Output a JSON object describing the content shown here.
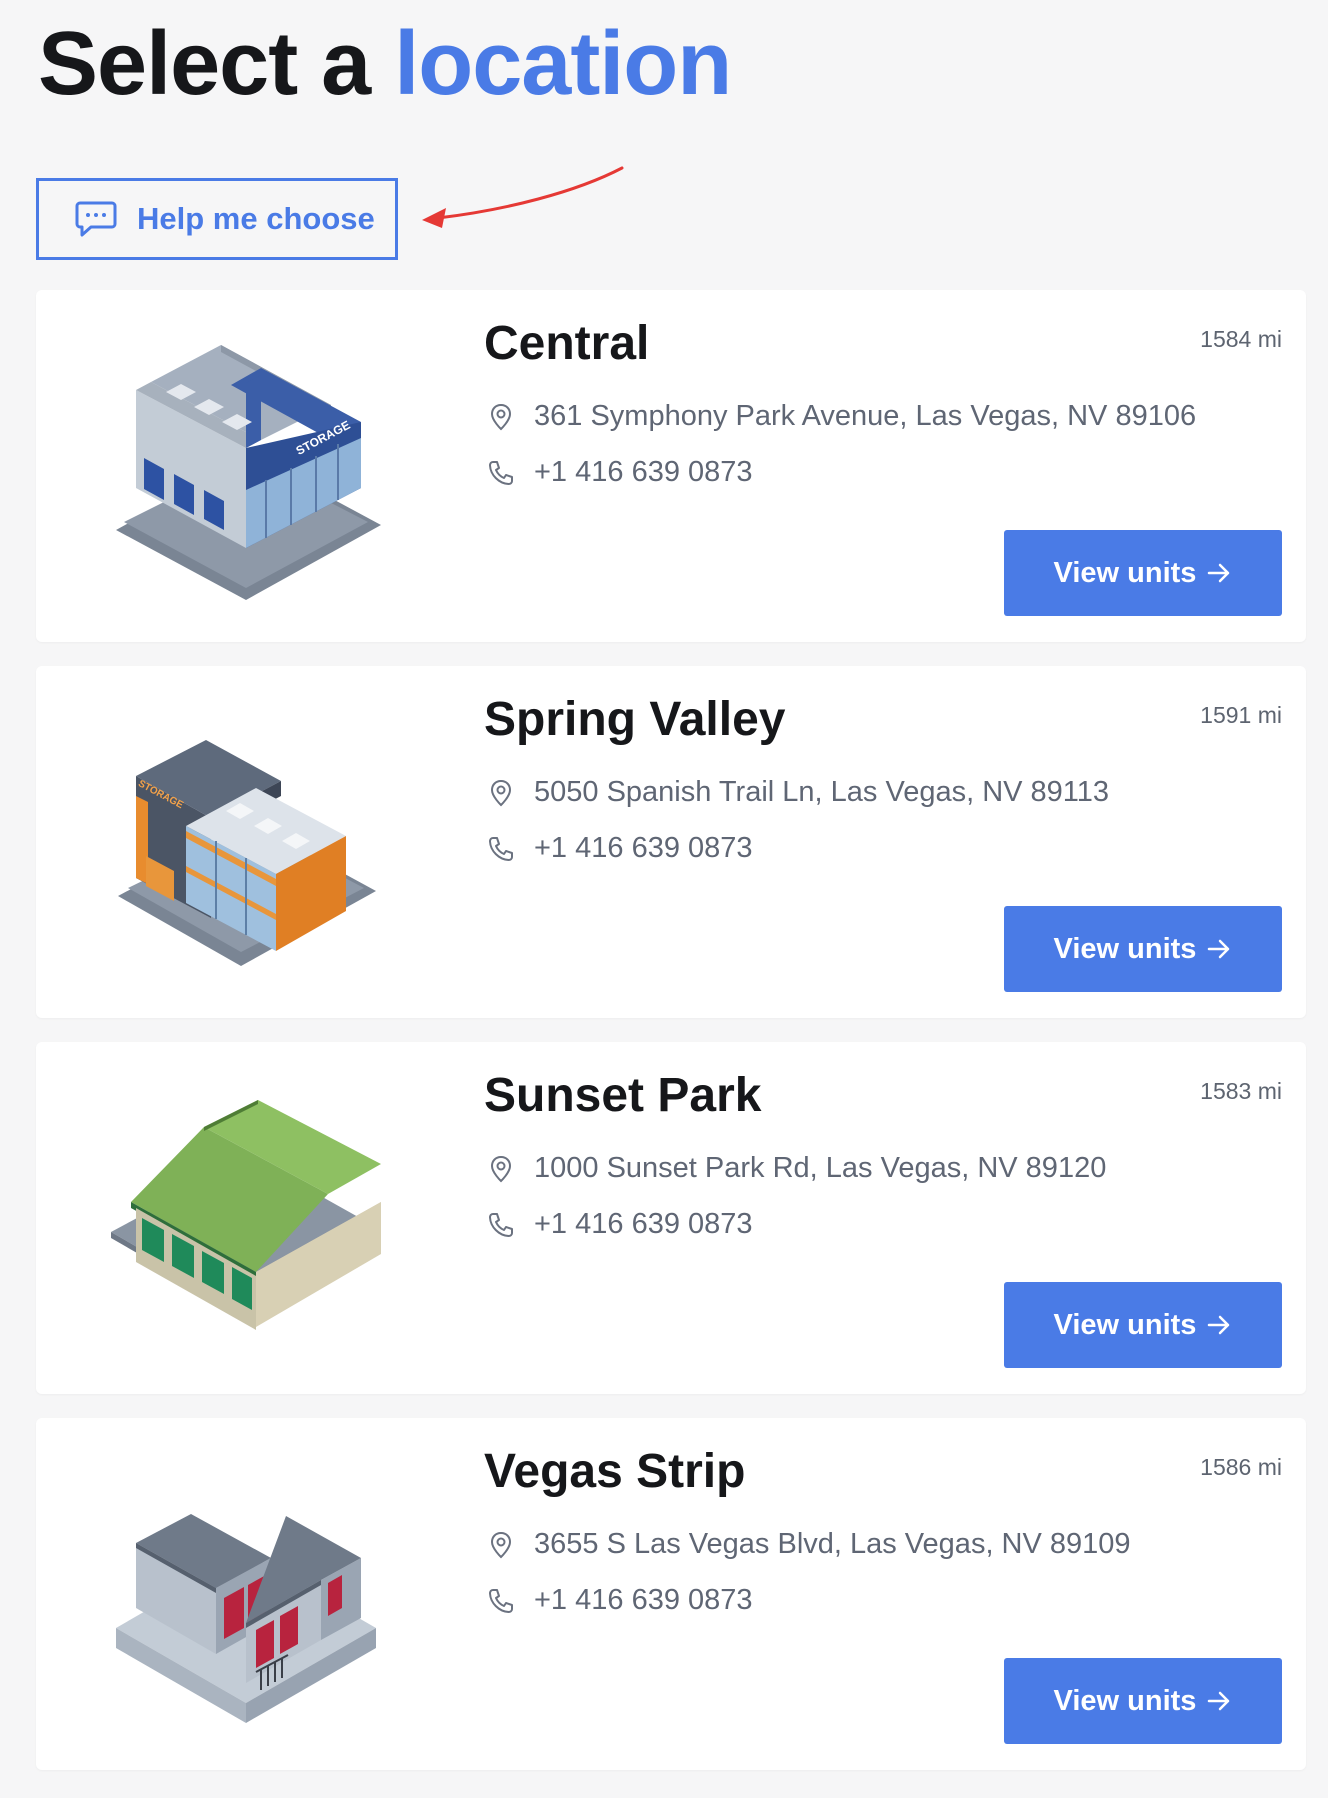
{
  "header": {
    "title_part1": "Select a ",
    "title_accent": "location"
  },
  "help_button": {
    "label": "Help me choose",
    "icon": "chat-bubble-icon"
  },
  "annotation": {
    "type": "arrow",
    "color": "#e53935"
  },
  "colors": {
    "accent": "#4a7be6",
    "background": "#f6f6f7",
    "card": "#ffffff",
    "text_muted": "#5f6674"
  },
  "locations": [
    {
      "name": "Central",
      "distance": "1584 mi",
      "address": "361 Symphony Park Avenue, Las Vegas, NV 89106",
      "phone": "+1 416 639 0873",
      "button_label": "View units",
      "illustration": "blue-storage-building",
      "illustration_label": "STORAGE"
    },
    {
      "name": "Spring Valley",
      "distance": "1591 mi",
      "address": "5050 Spanish Trail Ln, Las Vegas, NV 89113",
      "phone": "+1 416 639 0873",
      "button_label": "View units",
      "illustration": "orange-storage-building",
      "illustration_label": "STORAGE"
    },
    {
      "name": "Sunset Park",
      "distance": "1583 mi",
      "address": "1000 Sunset Park Rd, Las Vegas, NV 89120",
      "phone": "+1 416 639 0873",
      "button_label": "View units",
      "illustration": "green-roof-warehouse"
    },
    {
      "name": "Vegas Strip",
      "distance": "1586 mi",
      "address": "3655 S Las Vegas Blvd, Las Vegas, NV 89109",
      "phone": "+1 416 639 0873",
      "button_label": "View units",
      "illustration": "red-door-storage-units"
    }
  ]
}
